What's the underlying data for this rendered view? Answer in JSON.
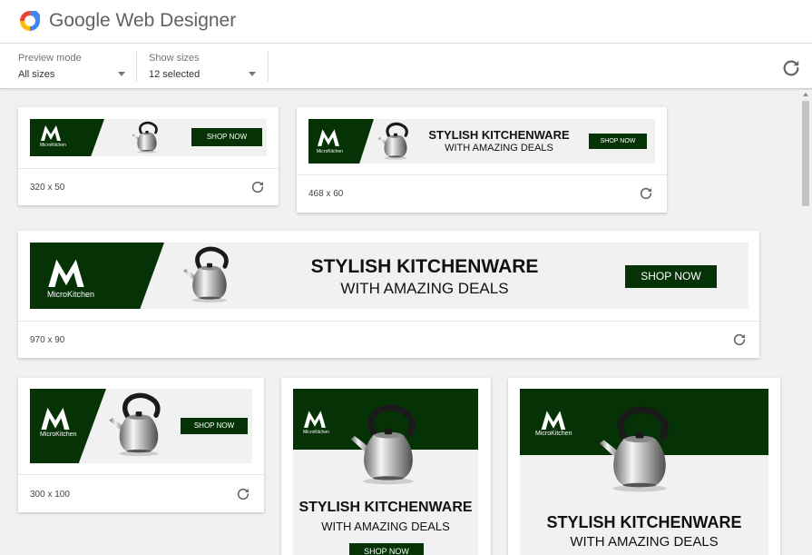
{
  "app": {
    "title": "Google Web Designer"
  },
  "toolbar": {
    "preview_mode": {
      "label": "Preview mode",
      "value": "All sizes"
    },
    "show_sizes": {
      "label": "Show sizes",
      "value": "12 selected"
    }
  },
  "ad_copy": {
    "headline": "STYLISH KITCHENWARE",
    "subline": "WITH AMAZING DEALS",
    "cta": "SHOP NOW",
    "brand": "MicroKitchen"
  },
  "previews": [
    {
      "size": "320 x 50"
    },
    {
      "size": "468 x 60"
    },
    {
      "size": "970 x 90"
    },
    {
      "size": "300 x 100"
    },
    {
      "size": ""
    },
    {
      "size": ""
    }
  ],
  "colors": {
    "brand_green": "#053306",
    "ad_background": "#f1f1f1",
    "canvas_background": "#f1f1f1",
    "logo_red": "#ea4335",
    "logo_yellow": "#fbbc05",
    "logo_blue": "#4285f4"
  },
  "icons": [
    "app-logo-icon",
    "refresh-icon",
    "dropdown-caret-icon",
    "kettle-image",
    "microkitchen-logo"
  ]
}
